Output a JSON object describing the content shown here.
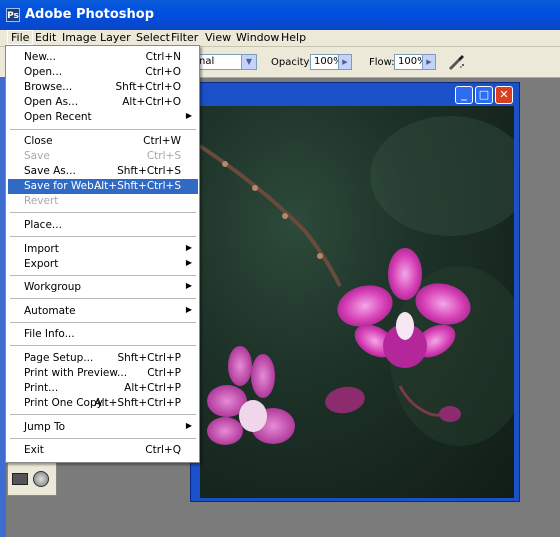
{
  "app": {
    "icon_letter": "Ps",
    "title": "Adobe Photoshop"
  },
  "menubar": [
    "File",
    "Edit",
    "Image",
    "Layer",
    "Select",
    "Filter",
    "View",
    "Window",
    "Help"
  ],
  "options": {
    "mode_value": "nal",
    "opacity_label": "Opacity:",
    "opacity_value": "100%",
    "flow_label": "Flow:",
    "flow_value": "100%"
  },
  "window_buttons": {
    "minimize": "_",
    "maximize": "□",
    "close": "✕"
  },
  "file_menu": [
    {
      "label": "New...",
      "shortcut": "Ctrl+N"
    },
    {
      "label": "Open...",
      "shortcut": "Ctrl+O"
    },
    {
      "label": "Browse...",
      "shortcut": "Shft+Ctrl+O"
    },
    {
      "label": "Open As...",
      "shortcut": "Alt+Ctrl+O"
    },
    {
      "label": "Open Recent",
      "shortcut": "",
      "submenu": true
    },
    {
      "label": "Close",
      "shortcut": "Ctrl+W"
    },
    {
      "label": "Save",
      "shortcut": "Ctrl+S",
      "disabled": true
    },
    {
      "label": "Save As...",
      "shortcut": "Shft+Ctrl+S"
    },
    {
      "label": "Save for Web...",
      "shortcut": "Alt+Shft+Ctrl+S",
      "highlighted": true
    },
    {
      "label": "Revert",
      "shortcut": "",
      "disabled": true
    },
    {
      "label": "Place...",
      "shortcut": ""
    },
    {
      "label": "Import",
      "shortcut": "",
      "submenu": true
    },
    {
      "label": "Export",
      "shortcut": "",
      "submenu": true
    },
    {
      "label": "Workgroup",
      "shortcut": "",
      "submenu": true
    },
    {
      "label": "Automate",
      "shortcut": "",
      "submenu": true
    },
    {
      "label": "File Info...",
      "shortcut": ""
    },
    {
      "label": "Page Setup...",
      "shortcut": "Shft+Ctrl+P"
    },
    {
      "label": "Print with Preview...",
      "shortcut": "Ctrl+P"
    },
    {
      "label": "Print...",
      "shortcut": "Alt+Ctrl+P"
    },
    {
      "label": "Print One Copy",
      "shortcut": "Alt+Shft+Ctrl+P"
    },
    {
      "label": "Jump To",
      "shortcut": "",
      "submenu": true
    },
    {
      "label": "Exit",
      "shortcut": "Ctrl+Q"
    }
  ],
  "colors": {
    "titlebar": "#0a5bd8",
    "highlight": "#316ac5",
    "orchid": "#d53fb5"
  }
}
